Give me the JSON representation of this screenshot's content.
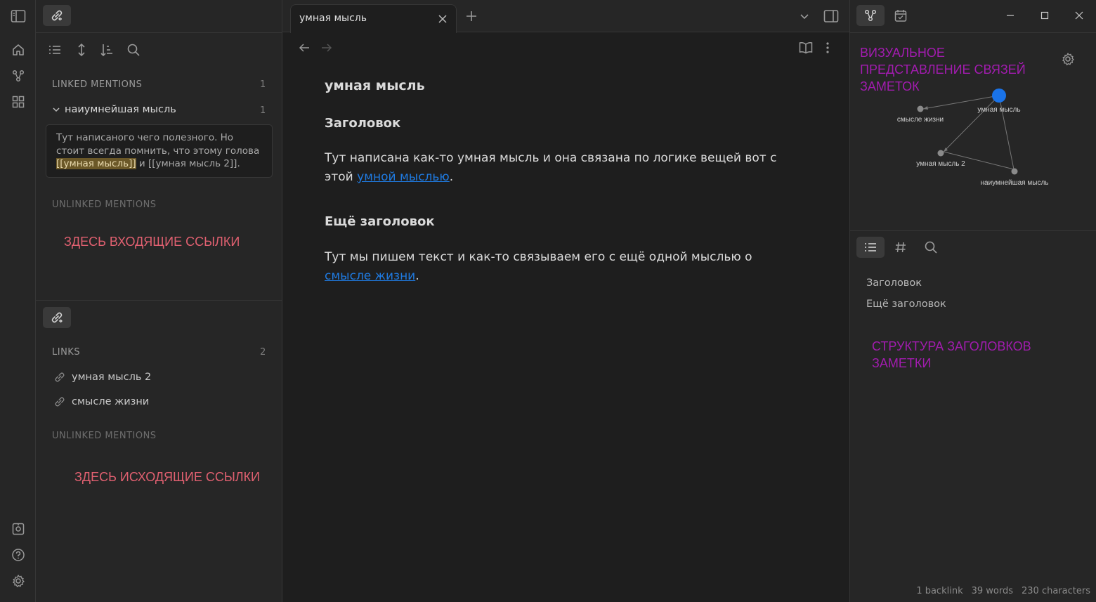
{
  "ribbon": {
    "top_icons": [
      "home-icon",
      "graph-icon",
      "blocks-icon"
    ],
    "bottom_icons": [
      "vault-icon",
      "help-icon",
      "settings-icon"
    ]
  },
  "backlinks": {
    "linked_title": "LINKED MENTIONS",
    "linked_count": "1",
    "file_name": "наиумнейшая мысль",
    "file_count": "1",
    "snippet_part1": "Тут написаного чего полезного. Но стоит всегда помнить, что этому голова ",
    "snippet_highlight": "[[умная мысль]]",
    "snippet_part2": " и [[умная мысль 2]].",
    "unlinked_title": "UNLINKED MENTIONS",
    "annotation": "ЗДЕСЬ ВХОДЯЩИЕ ССЫЛКИ"
  },
  "outgoing": {
    "links_title": "LINKS",
    "links_count": "2",
    "items": [
      "умная мысль 2",
      "смысле жизни"
    ],
    "unlinked_title": "UNLINKED MENTIONS",
    "annotation": "ЗДЕСЬ ИСХОДЯЩИЕ ССЫЛКИ"
  },
  "tab": {
    "title": "умная мысль"
  },
  "document": {
    "title": "умная мысль",
    "h1": "Заголовок",
    "p1_text": "Тут написана как-то умная мысль и она связана по логике вещей вот с этой ",
    "p1_link": "умной мыслью",
    "p1_end": ".",
    "h2": "Ещё заголовок",
    "p2_text": "Тут мы пишем текст и как-то связываем его с ещё одной мыслью о ",
    "p2_link": "смысле жизни",
    "p2_end": "."
  },
  "graph": {
    "annotation": "ВИЗУАЛЬНОЕ ПРЕДСТАВЛЕНИЕ СВЯЗЕЙ ЗАМЕТОК",
    "nodes": [
      "умная мысль",
      "смысле жизни",
      "умная мысль 2",
      "наиумнейшая мысль"
    ],
    "active_color": "#1a73e8"
  },
  "outline": {
    "items": [
      "Заголовок",
      "Ещё заголовок"
    ],
    "annotation": "СТРУКТУРА ЗАГОЛОВКОВ ЗАМЕТКИ"
  },
  "status": {
    "backlinks": "1 backlink",
    "words": "39 words",
    "chars": "230 characters"
  }
}
